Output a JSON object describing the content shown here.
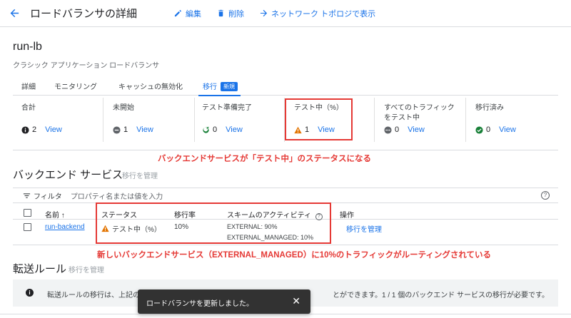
{
  "header": {
    "title": "ロードバランサの詳細",
    "actions": {
      "edit": "編集",
      "delete": "削除",
      "topology": "ネットワーク トポロジで表示"
    }
  },
  "lb": {
    "name": "run-lb",
    "type": "クラシック アプリケーション ロードバランサ"
  },
  "tabs": [
    {
      "label": "詳細"
    },
    {
      "label": "モニタリング"
    },
    {
      "label": "キャッシュの無効化"
    },
    {
      "label": "移行",
      "badge": "新規",
      "active": true
    }
  ],
  "migration_status": [
    {
      "label": "合計",
      "count": "2",
      "icon": "info-icon",
      "link": "View"
    },
    {
      "label": "未開始",
      "count": "1",
      "icon": "minus-circle-icon",
      "link": "View"
    },
    {
      "label": "テスト準備完了",
      "count": "0",
      "icon": "refresh-green-icon",
      "link": "View"
    },
    {
      "label": "テスト中（%）",
      "count": "1",
      "icon": "warning-icon",
      "link": "View"
    },
    {
      "label": "すべてのトラフィック をテスト中",
      "count": "0",
      "icon": "more-circle-icon",
      "link": "View"
    },
    {
      "label": "移行済み",
      "count": "0",
      "icon": "check-circle-icon",
      "link": "View"
    }
  ],
  "annotations": {
    "a1": "バックエンドサービスが「テスト中」のステータスになる",
    "a2": "新しいバックエンドサービス（EXTERNAL_MANAGED）に10%のトラフィックがルーティングされている"
  },
  "backend": {
    "title": "バックエンド サービス",
    "manage": "移行を管理",
    "filter_label": "フィルタ",
    "filter_placeholder": "プロパティ名または値を入力",
    "columns": {
      "name": "名前",
      "status": "ステータス",
      "rate": "移行率",
      "scheme": "スキームのアクティビティ",
      "ops": "操作"
    },
    "rows": [
      {
        "name": "run-backend",
        "status": "テスト中（%）",
        "rate": "10%",
        "scheme1": "EXTERNAL: 90%",
        "scheme2": "EXTERNAL_MANAGED: 10%",
        "action": "移行を管理"
      }
    ]
  },
  "forwarding": {
    "title": "転送ルール",
    "manage": "移行を管理",
    "info_start": "転送ルールの移行は、上記の",
    "info_end": "とができます。1 / 1 個のバックエンド サービスの移行が必要です。"
  },
  "toast": {
    "message": "ロードバランサを更新しました。",
    "close": "✕"
  },
  "colors": {
    "accent": "#1a73e8",
    "annotation": "#e53935",
    "warning": "#e37400",
    "success": "#188038"
  }
}
